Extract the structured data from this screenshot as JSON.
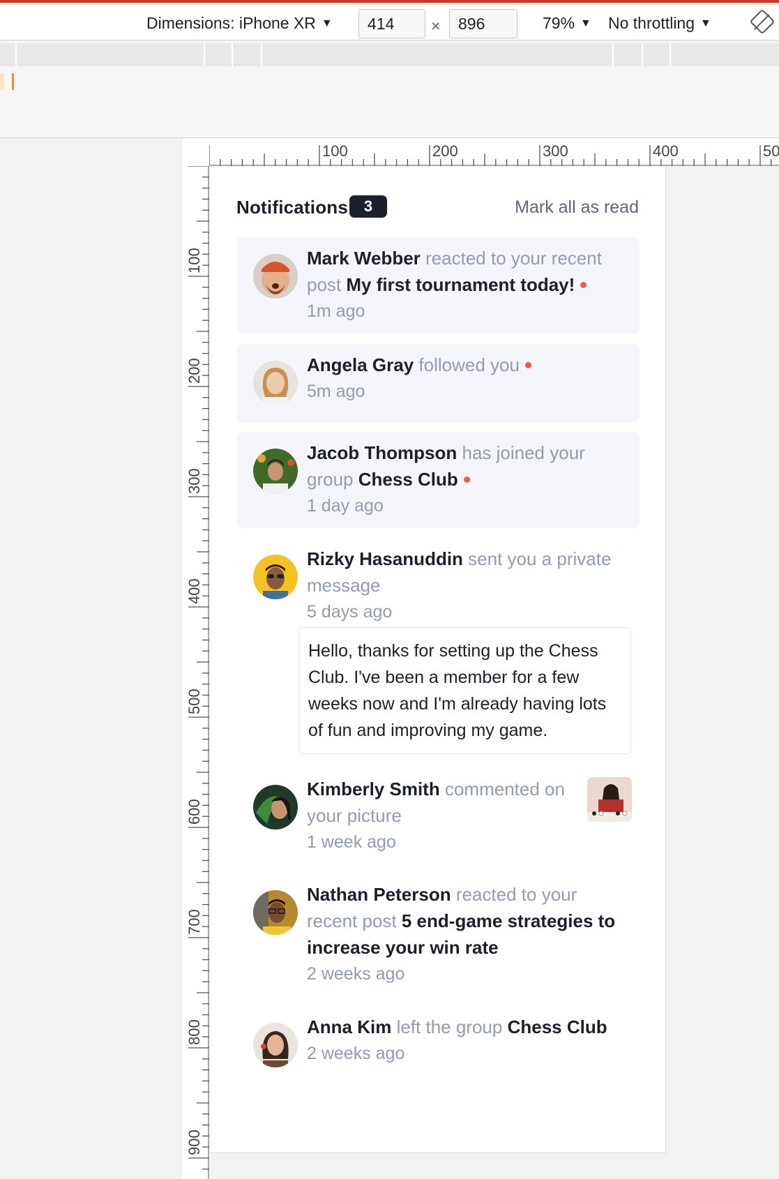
{
  "devtools": {
    "dimensions_label": "Dimensions: iPhone XR",
    "width_value": "414",
    "times_symbol": "×",
    "height_value": "896",
    "zoom_label": "79%",
    "throttling_label": "No throttling",
    "caret": "▼",
    "rotate_icon": "rotate-icon",
    "ruler_top_labels": [
      "100",
      "200",
      "300",
      "400",
      "50"
    ],
    "ruler_left_labels": [
      "100",
      "200",
      "300",
      "400",
      "500",
      "600",
      "700",
      "800",
      "900"
    ]
  },
  "header": {
    "title": "Notifications",
    "count": "3",
    "mark_all": "Mark all as read"
  },
  "colors": {
    "dark_text": "#1c202b",
    "grey_text": "#939caf",
    "unread_bg": "#f4f6fb",
    "red_dot": "#f65552"
  },
  "notifications": [
    {
      "name": "Mark Webber",
      "action": "reacted to your recent post",
      "target": "My first tournament today!",
      "time": "1m ago",
      "unread": true
    },
    {
      "name": "Angela Gray",
      "action": "followed you",
      "time": "5m ago",
      "unread": true
    },
    {
      "name": "Jacob Thompson",
      "action": "has joined your group",
      "target": "Chess Club",
      "time": "1 day ago",
      "unread": true
    },
    {
      "name": "Rizky Hasanuddin",
      "action": "sent you a private message",
      "time": "5 days ago",
      "unread": false,
      "message": "Hello, thanks for setting up the Chess Club. I've been a member for a few weeks now and I'm already having lots of fun and improving my game."
    },
    {
      "name": "Kimberly Smith",
      "action": "commented on your picture",
      "time": "1 week ago",
      "unread": false,
      "thumbnail": "chess-picture-thumbnail"
    },
    {
      "name": "Nathan Peterson",
      "action": "reacted to your recent post",
      "target": "5 end-game strategies to increase your win rate",
      "time": "2 weeks ago",
      "unread": false
    },
    {
      "name": "Anna Kim",
      "action": "left the group",
      "target": "Chess Club",
      "time": "2 weeks ago",
      "unread": false
    }
  ]
}
